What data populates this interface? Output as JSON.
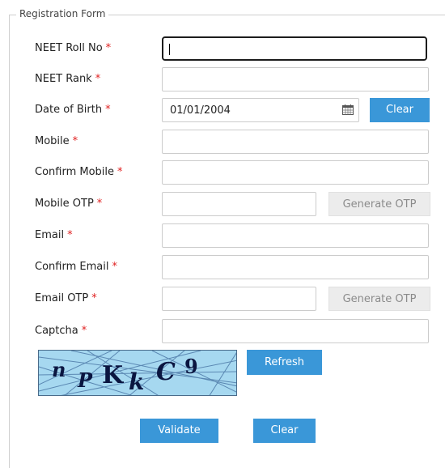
{
  "form": {
    "legend": "Registration Form",
    "fields": [
      {
        "label": "NEET Roll No",
        "required": "*",
        "value": ""
      },
      {
        "label": "NEET Rank",
        "required": "*",
        "value": ""
      },
      {
        "label": "Date of Birth",
        "required": "*",
        "value": "01/01/2004"
      },
      {
        "label": "Mobile",
        "required": "*",
        "value": ""
      },
      {
        "label": "Confirm Mobile",
        "required": "*",
        "value": ""
      },
      {
        "label": "Mobile OTP",
        "required": "*",
        "value": ""
      },
      {
        "label": "Email",
        "required": "*",
        "value": ""
      },
      {
        "label": "Confirm Email",
        "required": "*",
        "value": ""
      },
      {
        "label": "Email OTP",
        "required": "*",
        "value": ""
      },
      {
        "label": "Captcha",
        "required": "*",
        "value": ""
      }
    ],
    "dob_clear_label": "Clear",
    "mobile_generate_otp_label": "Generate OTP",
    "email_generate_otp_label": "Generate OTP",
    "refresh_label": "Refresh",
    "validate_label": "Validate",
    "clear_label": "Clear"
  },
  "captcha": {
    "characters": [
      "n",
      "P",
      "K",
      "k",
      "C",
      "9"
    ]
  },
  "colors": {
    "primary_button": "#3a97d8",
    "disabled_button": "#ececec",
    "required_star": "#e02020",
    "captcha_background": "#a6d8f0"
  },
  "icons": {
    "date_picker": "calendar-icon"
  }
}
